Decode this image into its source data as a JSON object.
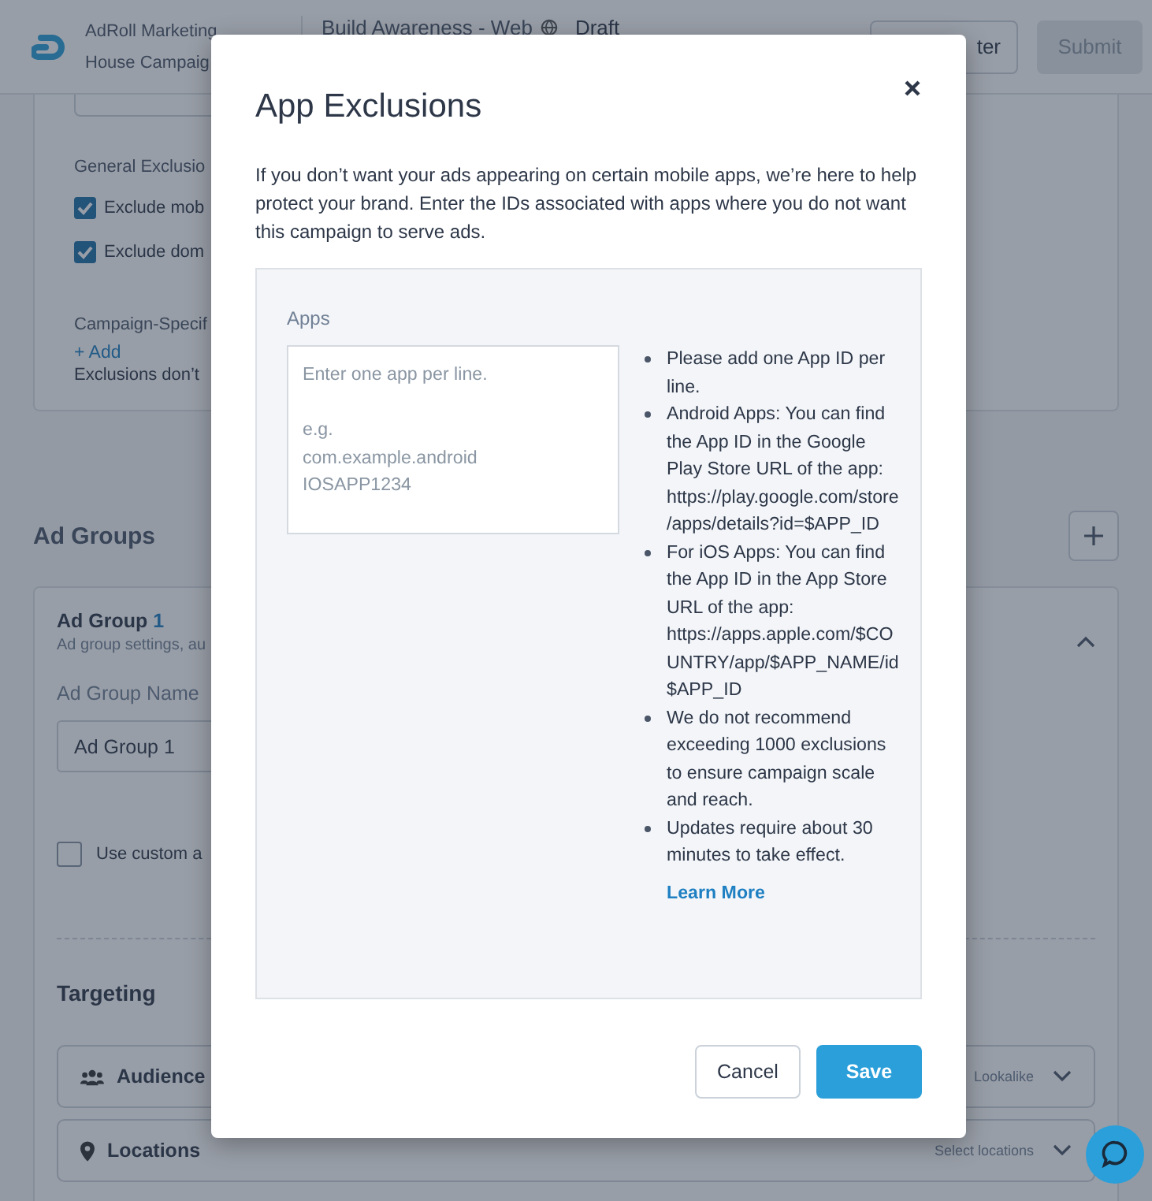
{
  "header": {
    "brand": [
      "AdRoll Marketing",
      "House Campaig"
    ],
    "campaign_title": "Build Awareness - Web",
    "status": "Draft",
    "buttons": [
      {
        "label": "ter",
        "kind": "outline",
        "disabled": false
      },
      {
        "label": "Submit",
        "kind": "primary",
        "disabled": true
      }
    ]
  },
  "exclusions_card": {
    "heading": "General Exclusio",
    "options": [
      {
        "label": "Exclude mob",
        "checked": true
      },
      {
        "label": "Exclude dom",
        "checked": true
      }
    ],
    "campaign_heading": "Campaign-Specif",
    "add_link": "+ Add",
    "note": "Exclusions don’t"
  },
  "ad_groups": {
    "title": "Ad Groups",
    "group": {
      "title": "Ad Group",
      "number": "1",
      "subtitle": "Ad group settings, au",
      "expanded": true,
      "name_label": "Ad Group Name",
      "name_value": "Ad Group 1",
      "custom_option": {
        "label": "Use custom a",
        "checked": false
      },
      "targeting": {
        "title": "Targeting",
        "rows": [
          {
            "kind": "audience",
            "label": "Audience",
            "value": "Lookalike"
          },
          {
            "kind": "location",
            "label": "Locations",
            "value": "Select locations"
          }
        ]
      }
    }
  },
  "dialog": {
    "title": "App Exclusions",
    "description": "If you don’t want your ads appearing on certain mobile apps, we’re here to help protect your brand. Enter the IDs associated with apps where you do not want this campaign to serve ads.",
    "apps_label": "Apps",
    "apps_placeholder": "Enter one app per line.\n\ne.g.\ncom.example.android\nIOSAPP1234",
    "tips": [
      "Please add one App ID per line.",
      "Android Apps: You can find the App ID in the Google Play Store URL of the app: https://play.google.com/store/apps/details?id=$APP_ID",
      "For iOS Apps: You can find the App ID in the App Store URL of the app: https://apps.apple.com/$COUNTRY/app/$APP_NAME/id$APP_ID",
      "We do not recommend exceeding 1000 exclusions to ensure campaign scale and reach.",
      "Updates require about 30 minutes to take effect."
    ],
    "learn_more": "Learn More",
    "buttons": [
      {
        "label": "Cancel",
        "kind": "secondary"
      },
      {
        "label": "Save",
        "kind": "primary"
      }
    ]
  }
}
